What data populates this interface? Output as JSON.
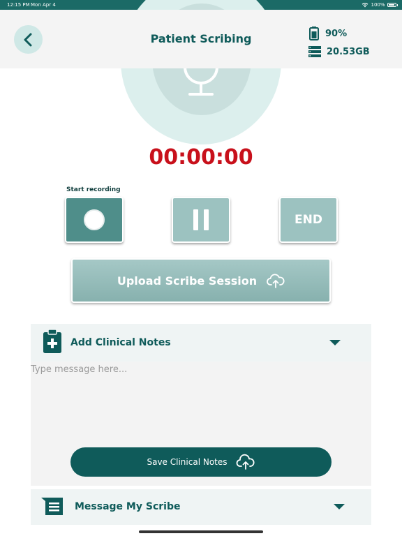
{
  "status_bar": {
    "time": "12:15 PM",
    "date": "Mon Apr 4",
    "battery": "100%"
  },
  "header": {
    "title": "Patient Scribing",
    "battery_level": "90%",
    "storage": "20.53GB"
  },
  "recorder": {
    "timer": "00:00:00",
    "start_label": "Start recording",
    "end_label": "END",
    "upload_label": "Upload Scribe Session"
  },
  "clinical_notes": {
    "title": "Add Clinical Notes",
    "placeholder": "Type message here...",
    "save_label": "Save Clinical Notes"
  },
  "message_scribe": {
    "title": "Message My Scribe"
  },
  "colors": {
    "primary": "#0f5b5a",
    "timer": "#c8101b",
    "button_light": "#9cc2c0",
    "button_active": "#4f8e8a",
    "ring_outer": "#dcefed",
    "ring_inner": "#c9dfdd"
  },
  "icons": {
    "back": "chevron-left-icon",
    "battery": "battery-icon",
    "storage": "storage-icon",
    "mic": "microphone-icon",
    "upload": "cloud-upload-icon",
    "notes": "clipboard-plus-icon",
    "scribe": "message-list-icon"
  }
}
